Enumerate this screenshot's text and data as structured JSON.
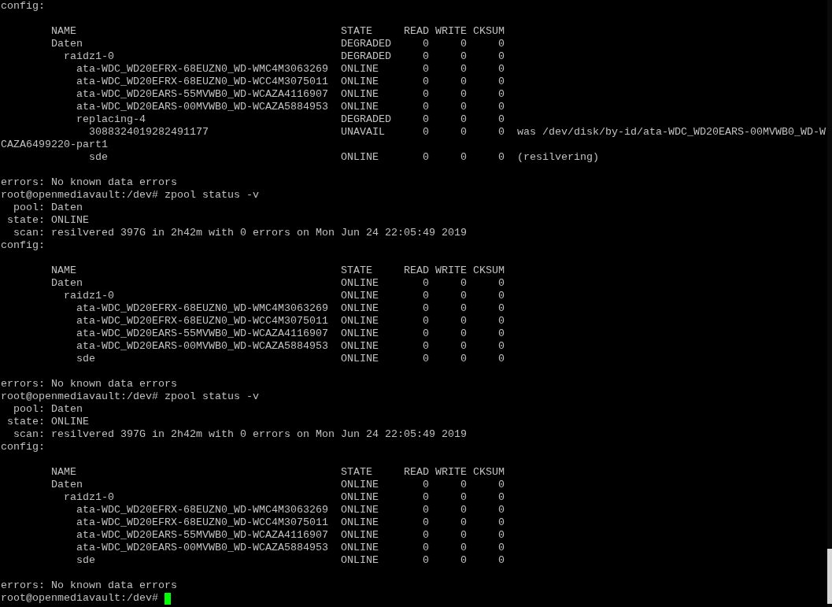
{
  "terminal": {
    "outputs": [
      {
        "config_label": "config:",
        "columns": [
          "NAME",
          "STATE",
          "READ",
          "WRITE",
          "CKSUM"
        ],
        "tree": [
          {
            "name": "Daten",
            "state": "DEGRADED",
            "read": "0",
            "write": "0",
            "cksum": "0",
            "children": [
              {
                "name": "raidz1-0",
                "state": "DEGRADED",
                "read": "0",
                "write": "0",
                "cksum": "0",
                "children": [
                  {
                    "name": "ata-WDC_WD20EFRX-68EUZN0_WD-WMC4M3063269",
                    "state": "ONLINE",
                    "read": "0",
                    "write": "0",
                    "cksum": "0"
                  },
                  {
                    "name": "ata-WDC_WD20EFRX-68EUZN0_WD-WCC4M3075011",
                    "state": "ONLINE",
                    "read": "0",
                    "write": "0",
                    "cksum": "0"
                  },
                  {
                    "name": "ata-WDC_WD20EARS-55MVWB0_WD-WCAZA4116907",
                    "state": "ONLINE",
                    "read": "0",
                    "write": "0",
                    "cksum": "0"
                  },
                  {
                    "name": "ata-WDC_WD20EARS-00MVWB0_WD-WCAZA5884953",
                    "state": "ONLINE",
                    "read": "0",
                    "write": "0",
                    "cksum": "0"
                  },
                  {
                    "name": "replacing-4",
                    "state": "DEGRADED",
                    "read": "0",
                    "write": "0",
                    "cksum": "0",
                    "children": [
                      {
                        "name": "3088324019282491177",
                        "state": "UNAVAIL",
                        "read": "0",
                        "write": "0",
                        "cksum": "0",
                        "note": "was /dev/disk/by-id/ata-WDC_WD20EARS-00MVWB0_WD-W",
                        "note_wrap": "CAZA6499220-part1"
                      },
                      {
                        "name": "sde",
                        "state": "ONLINE",
                        "read": "0",
                        "write": "0",
                        "cksum": "0",
                        "note": "(resilvering)"
                      }
                    ]
                  }
                ]
              }
            ]
          }
        ],
        "errors": "errors: No known data errors"
      },
      {
        "prompt": "root@openmediavault:/dev#",
        "command": "zpool status -v",
        "fields": [
          {
            "label": "pool:",
            "value": "Daten"
          },
          {
            "label": "state:",
            "value": "ONLINE"
          },
          {
            "label": "scan:",
            "value": "resilvered 397G in 2h42m with 0 errors on Mon Jun 24 22:05:49 2019"
          }
        ],
        "config_label": "config:",
        "columns": [
          "NAME",
          "STATE",
          "READ",
          "WRITE",
          "CKSUM"
        ],
        "tree": [
          {
            "name": "Daten",
            "state": "ONLINE",
            "read": "0",
            "write": "0",
            "cksum": "0",
            "children": [
              {
                "name": "raidz1-0",
                "state": "ONLINE",
                "read": "0",
                "write": "0",
                "cksum": "0",
                "children": [
                  {
                    "name": "ata-WDC_WD20EFRX-68EUZN0_WD-WMC4M3063269",
                    "state": "ONLINE",
                    "read": "0",
                    "write": "0",
                    "cksum": "0"
                  },
                  {
                    "name": "ata-WDC_WD20EFRX-68EUZN0_WD-WCC4M3075011",
                    "state": "ONLINE",
                    "read": "0",
                    "write": "0",
                    "cksum": "0"
                  },
                  {
                    "name": "ata-WDC_WD20EARS-55MVWB0_WD-WCAZA4116907",
                    "state": "ONLINE",
                    "read": "0",
                    "write": "0",
                    "cksum": "0"
                  },
                  {
                    "name": "ata-WDC_WD20EARS-00MVWB0_WD-WCAZA5884953",
                    "state": "ONLINE",
                    "read": "0",
                    "write": "0",
                    "cksum": "0"
                  },
                  {
                    "name": "sde",
                    "state": "ONLINE",
                    "read": "0",
                    "write": "0",
                    "cksum": "0"
                  }
                ]
              }
            ]
          }
        ],
        "errors": "errors: No known data errors"
      },
      {
        "prompt": "root@openmediavault:/dev#",
        "command": "zpool status -v",
        "fields": [
          {
            "label": "pool:",
            "value": "Daten"
          },
          {
            "label": "state:",
            "value": "ONLINE"
          },
          {
            "label": "scan:",
            "value": "resilvered 397G in 2h42m with 0 errors on Mon Jun 24 22:05:49 2019"
          }
        ],
        "config_label": "config:",
        "columns": [
          "NAME",
          "STATE",
          "READ",
          "WRITE",
          "CKSUM"
        ],
        "tree": [
          {
            "name": "Daten",
            "state": "ONLINE",
            "read": "0",
            "write": "0",
            "cksum": "0",
            "children": [
              {
                "name": "raidz1-0",
                "state": "ONLINE",
                "read": "0",
                "write": "0",
                "cksum": "0",
                "children": [
                  {
                    "name": "ata-WDC_WD20EFRX-68EUZN0_WD-WMC4M3063269",
                    "state": "ONLINE",
                    "read": "0",
                    "write": "0",
                    "cksum": "0"
                  },
                  {
                    "name": "ata-WDC_WD20EFRX-68EUZN0_WD-WCC4M3075011",
                    "state": "ONLINE",
                    "read": "0",
                    "write": "0",
                    "cksum": "0"
                  },
                  {
                    "name": "ata-WDC_WD20EARS-55MVWB0_WD-WCAZA4116907",
                    "state": "ONLINE",
                    "read": "0",
                    "write": "0",
                    "cksum": "0"
                  },
                  {
                    "name": "ata-WDC_WD20EARS-00MVWB0_WD-WCAZA5884953",
                    "state": "ONLINE",
                    "read": "0",
                    "write": "0",
                    "cksum": "0"
                  },
                  {
                    "name": "sde",
                    "state": "ONLINE",
                    "read": "0",
                    "write": "0",
                    "cksum": "0"
                  }
                ]
              }
            ]
          }
        ],
        "errors": "errors: No known data errors"
      }
    ],
    "prompt": {
      "text": "root@openmediavault:/dev#",
      "cursor": true
    }
  }
}
